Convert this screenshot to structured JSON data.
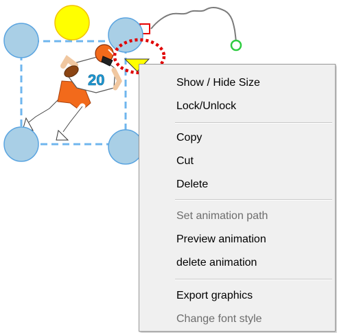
{
  "canvas": {
    "player_image": "football-player-number-20",
    "player_number": "20",
    "colors": {
      "handle_fill": "#a9cfe6",
      "handle_stroke": "#5aa4e0",
      "rotate_handle": "#ffff00",
      "selection_border": "#6fb6ee",
      "highlight_ring": "#e00000",
      "anchor_square": "#e60000",
      "path_endpoint": "#2ecc40",
      "path_line": "#7a7a7a",
      "pointer_triangle": "#ffff00"
    }
  },
  "context_menu": {
    "items": [
      {
        "label": "Show / Hide Size",
        "enabled": true
      },
      {
        "label": "Lock/Unlock",
        "enabled": true
      },
      {
        "label": "Copy",
        "enabled": true
      },
      {
        "label": "Cut",
        "enabled": true
      },
      {
        "label": "Delete",
        "enabled": true
      },
      {
        "label": "Set animation path",
        "enabled": false
      },
      {
        "label": "Preview animation",
        "enabled": true
      },
      {
        "label": "delete animation",
        "enabled": true
      },
      {
        "label": "Export graphics",
        "enabled": true
      },
      {
        "label": "Change font style",
        "enabled": false
      }
    ]
  }
}
